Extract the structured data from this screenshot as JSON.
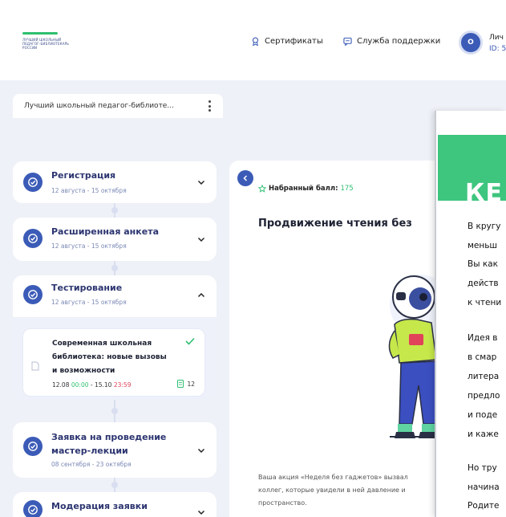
{
  "header": {
    "logo_lines": [
      "ЛУЧШИЙ ШКОЛЬНЫЙ",
      "ПЕДАГОГ-БИБЛИОТЕКАРЬ",
      "РОССИИ"
    ],
    "nav": {
      "certificates": "Сертификаты",
      "support": "Служба поддержки"
    },
    "avatar_initial": "О",
    "account_label": "Лич",
    "account_id": "ID: 5"
  },
  "course_tab": {
    "label": "Лучший школьный педагог-библиоте..."
  },
  "steps": [
    {
      "title": "Регистрация",
      "date": "12 августа - 15 октября",
      "expanded": false
    },
    {
      "title": "Расширенная анкета",
      "date": "12 августа - 15 октября",
      "expanded": false
    },
    {
      "title": "Тестирование",
      "date": "12 августа - 15 октября",
      "expanded": true
    },
    {
      "title_line1": "Заявка на проведение",
      "title_line2": "мастер-лекции",
      "date": "08 сентября - 23 октября",
      "expanded": false
    },
    {
      "title": "Модерация заявки",
      "expanded": false
    }
  ],
  "test_card": {
    "title": "Современная школьная библиотека: новые вызовы и возможности",
    "start_date": "12.08",
    "start_time": "00:00",
    "separator": " - ",
    "end_date": "15.10",
    "end_time": "23:59",
    "attempts": "12"
  },
  "main": {
    "score_label": "Набранный балл:",
    "score_value": "175",
    "task_title": "Продвижение чтения без",
    "description_line1": "Ваша акция «Неделя без гаджетов» вызвал",
    "description_line2": "коллег, которые увидели в ней давление и",
    "description_line3": "пространство."
  },
  "overlay": {
    "banner_text": "КЕ",
    "lines": [
      "В кругу",
      "меньш",
      "Вы как",
      "действ",
      "к чтени",
      "Идея в",
      "в смар",
      "литера",
      "предло",
      "и поде",
      "и каже",
      "Но тру",
      "начина",
      "Родите"
    ]
  },
  "colors": {
    "brand_blue": "#3b5bb7",
    "accent_green": "#2fbf71",
    "alert_red": "#e0435a",
    "banner_green": "#3ec57e"
  }
}
